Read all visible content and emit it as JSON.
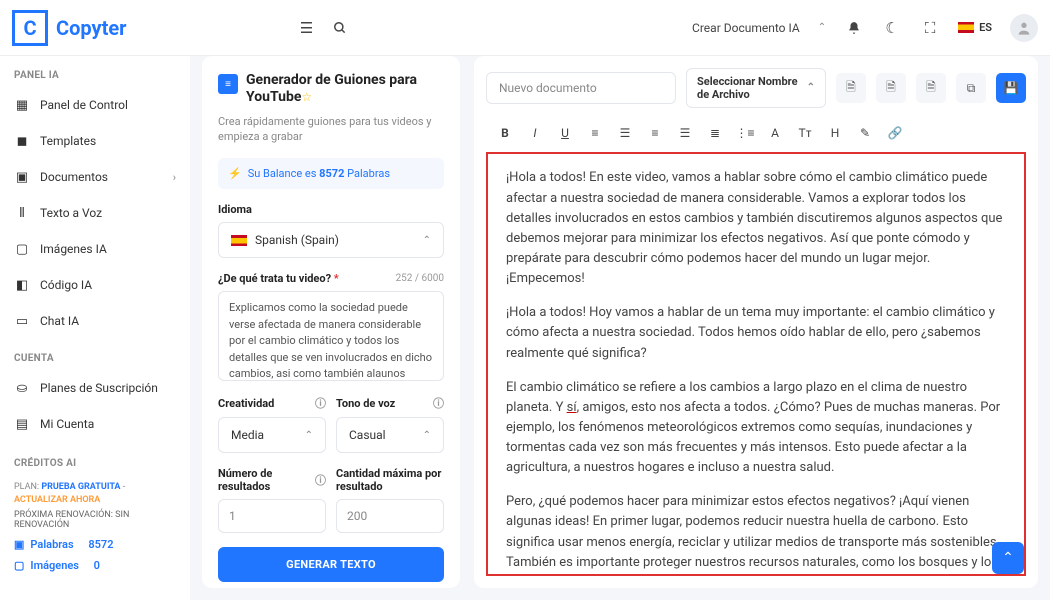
{
  "header": {
    "logo_letter": "C",
    "logo_text": "Copyter",
    "crear_doc": "Crear Documento IA",
    "lang": "ES"
  },
  "sidebar": {
    "section_panel": "PANEL IA",
    "items_panel": [
      "Panel de Control",
      "Templates",
      "Documentos",
      "Texto a Voz",
      "Imágenes IA",
      "Código IA",
      "Chat IA"
    ],
    "section_cuenta": "CUENTA",
    "items_cuenta": [
      "Planes de Suscripción",
      "Mi Cuenta"
    ],
    "section_credits": "CRÉDITOS AI",
    "plan_prefix": "PLAN: ",
    "plan_name": "PRUEBA GRATUITA",
    "plan_sep": " - ",
    "plan_action": "ACTUALIZAR AHORA",
    "renov": "PRÓXIMA RENOVACIÓN: SIN RENOVACIÓN",
    "palabras_label": "Palabras",
    "palabras_val": "8572",
    "imagenes_label": "Imágenes",
    "imagenes_val": "0"
  },
  "form": {
    "title": "Generador de Guiones para YouTube",
    "subtitle": "Crea rápidamente guiones para tus videos y empieza a grabar",
    "balance_pre": "Su Balance es ",
    "balance_num": "8572",
    "balance_post": " Palabras",
    "idioma_label": "Idioma",
    "idioma_value": "Spanish (Spain)",
    "topic_label": "¿De qué trata tu video?",
    "topic_counter": "252 / 6000",
    "topic_value": "Explicamos como la sociedad puede verse afectada de manera considerable por el cambio climático y todos los detalles que se ven involucrados en dicho cambios, asi como también alaunos aspectos aue",
    "creatividad_label": "Creatividad",
    "creatividad_value": "Media",
    "tono_label": "Tono de voz",
    "tono_value": "Casual",
    "numres_label": "Número de resultados",
    "numres_value": "1",
    "maxres_label": "Cantidad máxima por resultado",
    "maxres_value": "200",
    "generate": "GENERAR TEXTO"
  },
  "editor": {
    "doc_placeholder": "Nuevo documento",
    "file_select": "Seleccionar Nombre de Archivo",
    "p1": "¡Hola a todos! En este video, vamos a hablar sobre cómo el cambio climático puede afectar a nuestra sociedad de manera considerable. Vamos a explorar todos los detalles involucrados en estos cambios y también discutiremos algunos aspectos que debemos mejorar para minimizar los efectos negativos. Así que ponte cómodo y prepárate para descubrir cómo podemos hacer del mundo un lugar mejor. ¡Empecemos!",
    "p2": "¡Hola a todos! Hoy vamos a hablar de un tema muy importante: el cambio climático y cómo afecta a nuestra sociedad. Todos hemos oído hablar de ello, pero ¿sabemos realmente qué significa?",
    "p3a": "El cambio climático se refiere a los cambios a largo plazo en el clima de nuestro planeta. Y ",
    "p3_si": "sí",
    "p3b": ", amigos, esto nos afecta a todos. ¿Cómo? Pues de muchas maneras. Por ejemplo, los fenómenos meteorológicos extremos como sequías, inundaciones y tormentas cada vez son más frecuentes y más intensos. Esto puede afectar a la agricultura, a nuestros hogares e incluso a nuestra salud.",
    "p4": "Pero, ¿qué podemos hacer para minimizar estos efectos negativos? ¡Aquí vienen algunas ideas! En primer lugar, podemos reducir nuestra huella de carbono. Esto significa usar menos energía, reciclar y utilizar medios de transporte más sostenibles. También es importante proteger nuestros recursos naturales, como los bosques y los océanos, ya que actúan como reguladores del clima."
  }
}
